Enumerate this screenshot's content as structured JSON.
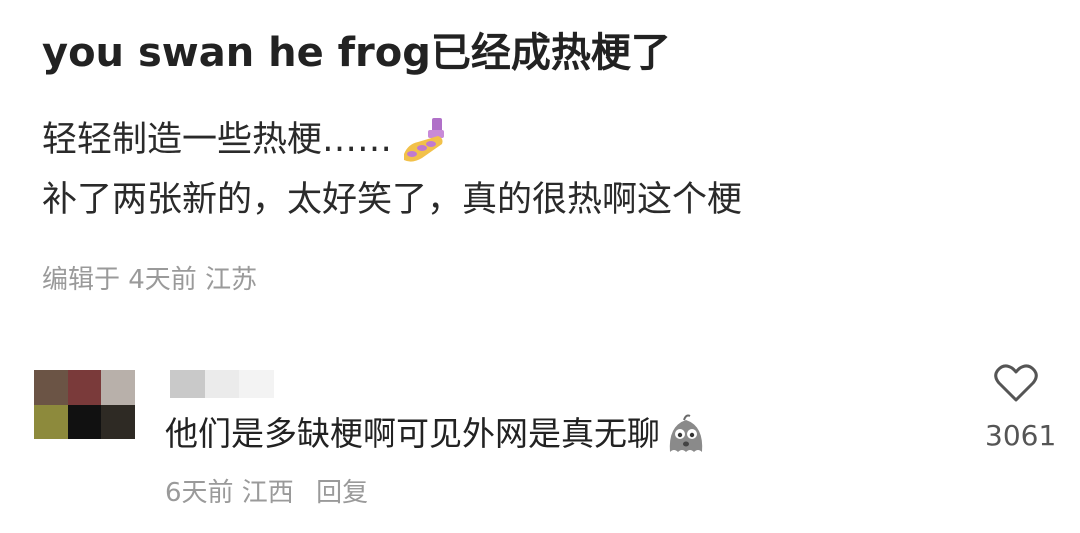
{
  "post": {
    "title": "you swan he frog已经成热梗了",
    "line1": "轻轻制造一些热梗……",
    "line2": "补了两张新的，太好笑了，真的很热啊这个梗",
    "meta": "编辑于 4天前 江苏",
    "emoji_icon": "nail-polish-emoji"
  },
  "comment": {
    "text": "他们是多缺梗啊可见外网是真无聊",
    "emoji_icon": "ghost-emoji",
    "meta": "6天前 江西",
    "reply_label": "回复",
    "like_count": "3061",
    "like_icon": "heart-icon"
  },
  "colors": {
    "title": "#222222",
    "meta": "#9a9a9a",
    "avatar_pixels": [
      "#6b5445",
      "#7a3a3a",
      "#b8b0aa",
      "#8d8a3c",
      "#111111",
      "#2e2a24"
    ],
    "username_pixels": [
      "#c9c9c9",
      "#ebebeb",
      "#f3f3f3"
    ]
  }
}
